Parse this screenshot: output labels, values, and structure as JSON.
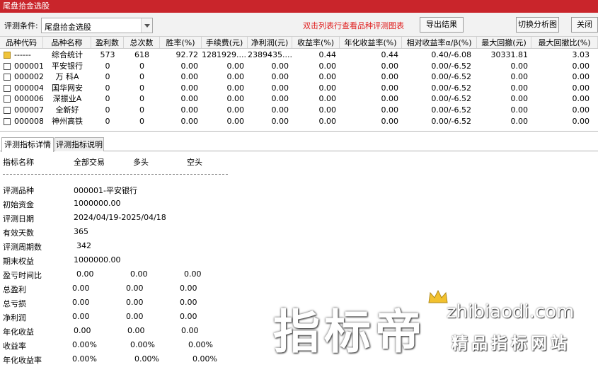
{
  "window": {
    "title": "尾盘拾金选股"
  },
  "toolbar": {
    "criteria_label": "评测条件:",
    "criteria_value": "尾盘拾金选股",
    "hint": "双击列表行查看品种评测图表",
    "export_label": "导出结果",
    "switch_label": "切换分析图",
    "close_label": "关闭"
  },
  "grid": {
    "columns": [
      "品种代码",
      "品种名称",
      "盈利数",
      "总次数",
      "胜率(%)",
      "手续费(元)",
      "净利润(元)",
      "收益率(%)",
      "年化收益率(%)",
      "相对收益率α/β(%)",
      "最大回撤(元)",
      "最大回撤比(%)"
    ],
    "rows": [
      {
        "code": "------",
        "name": "综合统计",
        "wins": "573",
        "total": "618",
        "winrate": "92.72",
        "fee": "1281929....",
        "profit": "2389435....",
        "return": "0.44",
        "annual": "0.44",
        "relative": "0.40/-6.08",
        "maxdd": "30331.81",
        "maxddpct": "3.03"
      },
      {
        "code": "000001",
        "name": "平安银行",
        "wins": "0",
        "total": "0",
        "winrate": "0.00",
        "fee": "0.00",
        "profit": "0.00",
        "return": "0.00",
        "annual": "0.00",
        "relative": "0.00/-6.52",
        "maxdd": "0.00",
        "maxddpct": "0.00"
      },
      {
        "code": "000002",
        "name": "万 科A",
        "wins": "0",
        "total": "0",
        "winrate": "0.00",
        "fee": "0.00",
        "profit": "0.00",
        "return": "0.00",
        "annual": "0.00",
        "relative": "0.00/-6.52",
        "maxdd": "0.00",
        "maxddpct": "0.00"
      },
      {
        "code": "000004",
        "name": "国华网安",
        "wins": "0",
        "total": "0",
        "winrate": "0.00",
        "fee": "0.00",
        "profit": "0.00",
        "return": "0.00",
        "annual": "0.00",
        "relative": "0.00/-6.52",
        "maxdd": "0.00",
        "maxddpct": "0.00"
      },
      {
        "code": "000006",
        "name": "深振业A",
        "wins": "0",
        "total": "0",
        "winrate": "0.00",
        "fee": "0.00",
        "profit": "0.00",
        "return": "0.00",
        "annual": "0.00",
        "relative": "0.00/-6.52",
        "maxdd": "0.00",
        "maxddpct": "0.00"
      },
      {
        "code": "000007",
        "name": "全新好",
        "wins": "0",
        "total": "0",
        "winrate": "0.00",
        "fee": "0.00",
        "profit": "0.00",
        "return": "0.00",
        "annual": "0.00",
        "relative": "0.00/-6.52",
        "maxdd": "0.00",
        "maxddpct": "0.00"
      },
      {
        "code": "000008",
        "name": "神州高铁",
        "wins": "0",
        "total": "0",
        "winrate": "0.00",
        "fee": "0.00",
        "profit": "0.00",
        "return": "0.00",
        "annual": "0.00",
        "relative": "0.00/-6.52",
        "maxdd": "0.00",
        "maxddpct": "0.00"
      }
    ]
  },
  "tabs": [
    {
      "label": "评测指标详情",
      "active": true
    },
    {
      "label": "评测指标说明",
      "active": false
    }
  ],
  "details": {
    "header": [
      "指标名称",
      "全部交易",
      "多头",
      "空头"
    ],
    "rows": [
      {
        "label": "评测品种",
        "v1": "000001-平安银行",
        "v2": "",
        "v3": ""
      },
      {
        "label": "初始资金",
        "v1": "1000000.00",
        "v2": "",
        "v3": ""
      },
      {
        "label": "评测日期",
        "v1": "2024/04/19-2025/04/18",
        "v2": "",
        "v3": ""
      },
      {
        "label": "有效天数",
        "v1": "365",
        "v2": "",
        "v3": ""
      },
      {
        "label": "评测周期数",
        "v1": "342",
        "v2": "",
        "v3": ""
      },
      {
        "label": "期末权益",
        "v1": "1000000.00",
        "v2": "",
        "v3": ""
      },
      {
        "label": "盈亏时间比",
        "v1": "0.00",
        "v2": "0.00",
        "v3": "0.00"
      },
      {
        "label": "总盈利",
        "v1": "0.00",
        "v2": "0.00",
        "v3": "0.00"
      },
      {
        "label": "总亏损",
        "v1": "0.00",
        "v2": "0.00",
        "v3": "0.00"
      },
      {
        "label": "净利润",
        "v1": "0.00",
        "v2": "0.00",
        "v3": "0.00"
      },
      {
        "label": "年化收益",
        "v1": "0.00",
        "v2": "0.00",
        "v3": "0.00"
      },
      {
        "label": "收益率",
        "v1": "0.00%",
        "v2": "0.00%",
        "v3": "0.00%"
      },
      {
        "label": "年化收益率",
        "v1": "0.00%",
        "v2": "0.00%",
        "v3": "0.00%"
      }
    ]
  },
  "watermark": {
    "brand": "指标帝",
    "url": "zhibiaodi.com",
    "slogan": "精品指标网站"
  }
}
